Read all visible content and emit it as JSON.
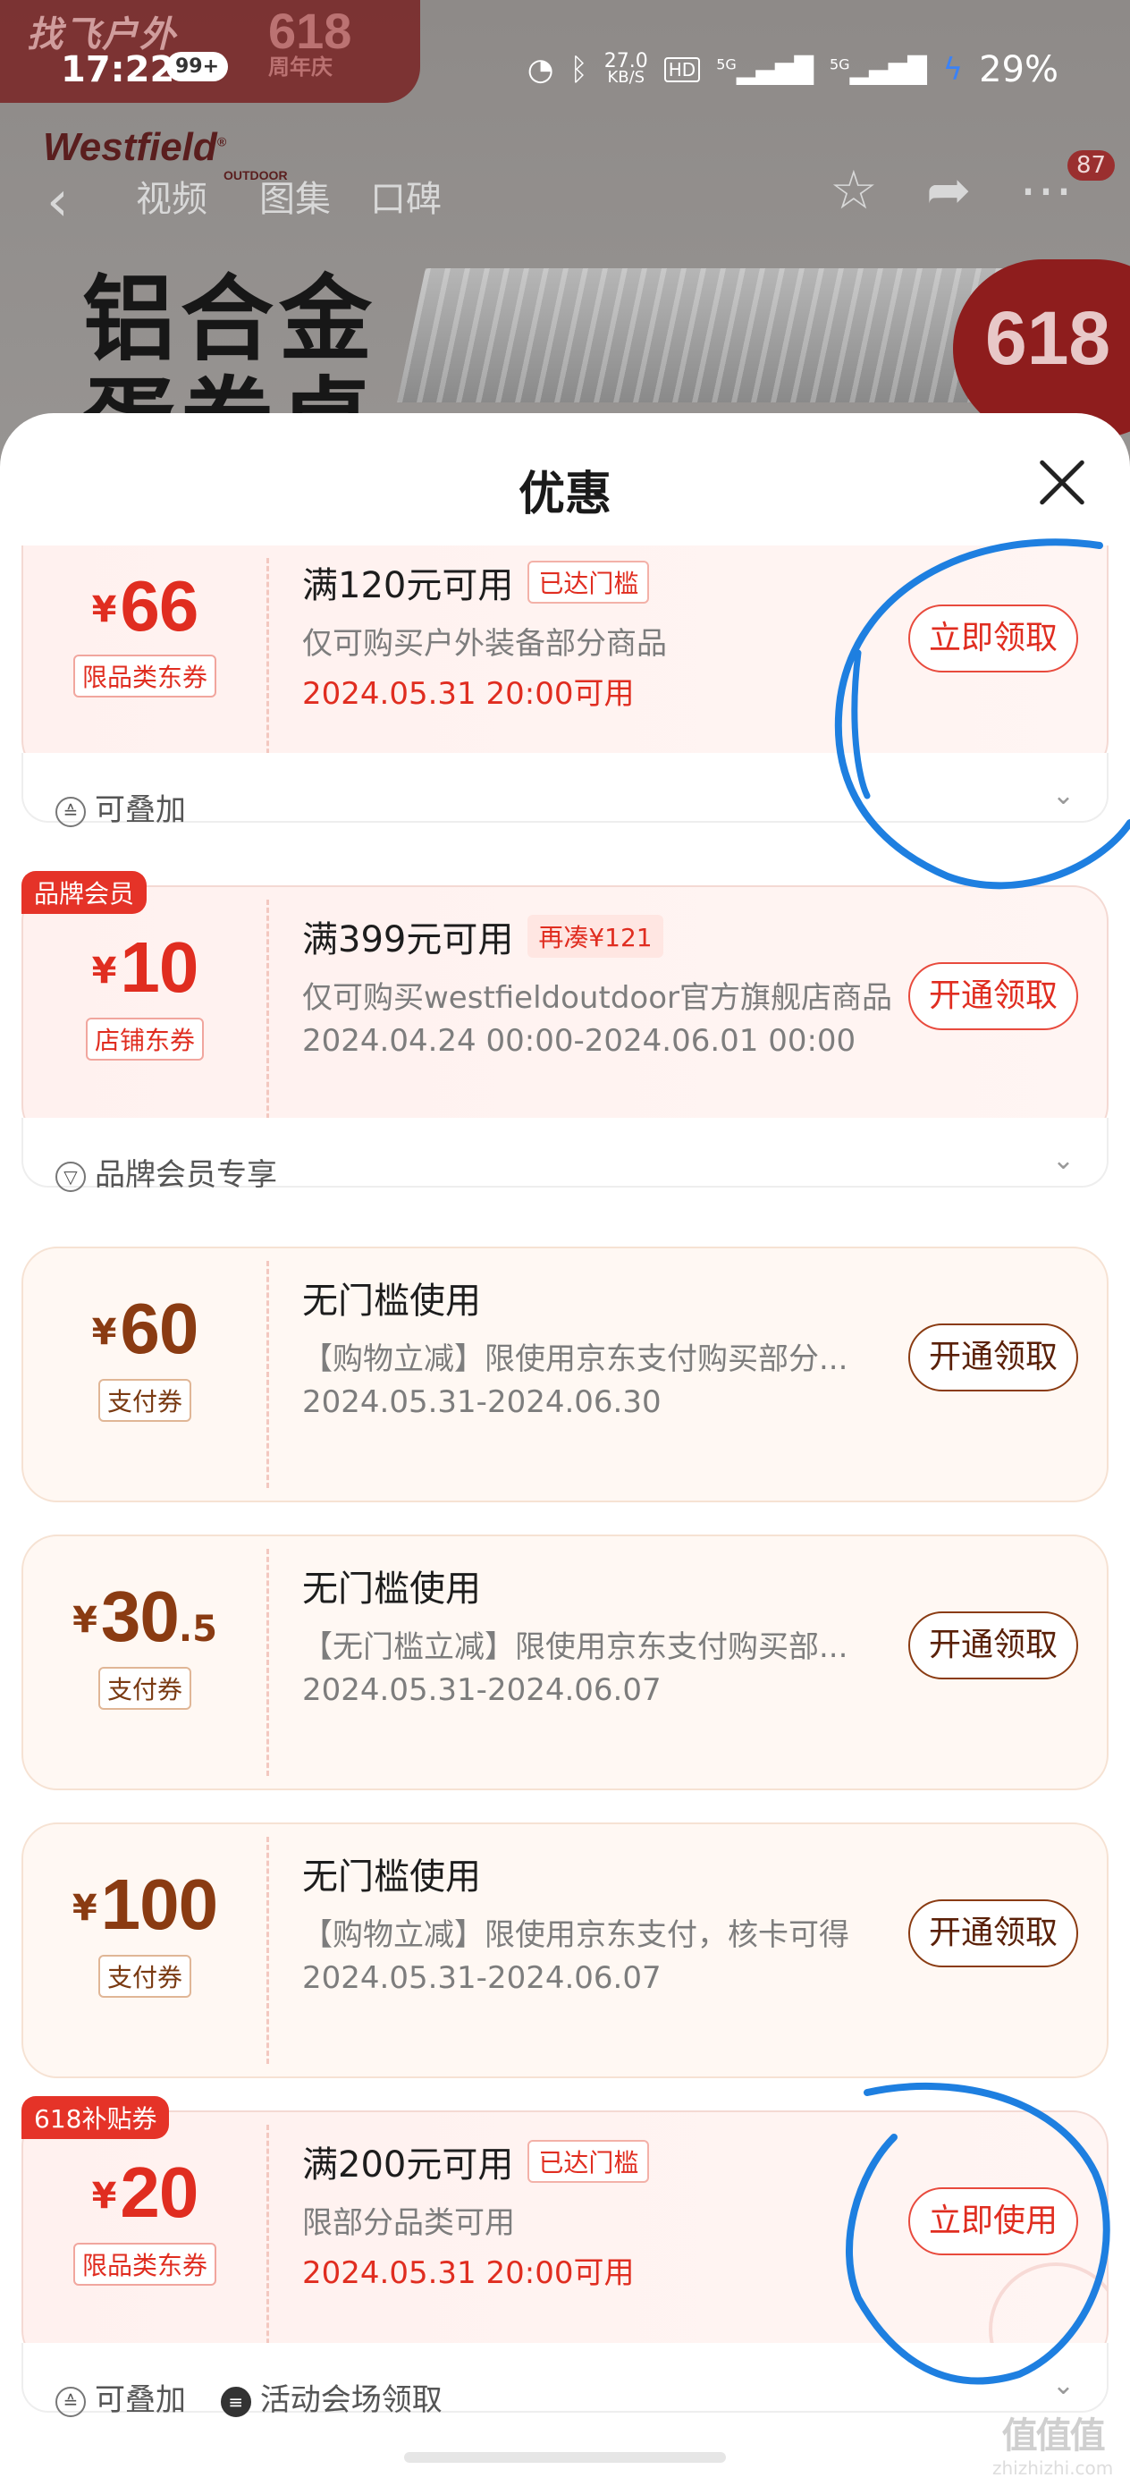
{
  "status_bar": {
    "time": "17:22",
    "notification_badge": "99+",
    "speed": "27.0",
    "speed_unit": "KB/S",
    "hd": "HD",
    "net1": "5G",
    "net2": "5G",
    "battery": "29%"
  },
  "background": {
    "banner_text": "找飞户外",
    "banner_618": "618",
    "banner_anniv": "周年庆",
    "logo": "Westfield",
    "logo_sub": "OUTDOOR",
    "headline_line1": "铝合金",
    "headline_line2": "蛋卷桌",
    "badge_618": "618",
    "nav": {
      "tab_video": "视频",
      "tab_gallery": "图集",
      "tab_reviews": "口碑",
      "more_badge": "87"
    }
  },
  "sheet": {
    "title": "优惠",
    "coupons": [
      {
        "currency": "¥",
        "amount": "66",
        "decimal": "",
        "type": "限品类东券",
        "condition": "满120元可用",
        "tag": "已达门槛",
        "description": "仅可购买户外装备部分商品",
        "date": "2024.05.31 20:00可用",
        "button": "立即领取",
        "footer": [
          "可叠加"
        ],
        "corner": ""
      },
      {
        "currency": "¥",
        "amount": "10",
        "decimal": "",
        "type": "店铺东券",
        "condition": "满399元可用",
        "tag": "再凑¥121",
        "description": "仅可购买westfieldoutdoor官方旗舰店商品",
        "date": "2024.04.24 00:00-2024.06.01 00:00",
        "button": "开通领取",
        "footer": [
          "品牌会员专享"
        ],
        "corner": "品牌会员"
      },
      {
        "currency": "¥",
        "amount": "60",
        "decimal": "",
        "type": "支付券",
        "condition": "无门槛使用",
        "tag": "",
        "description": "【购物立减】限使用京东支付购买部分...",
        "date": "2024.05.31-2024.06.30",
        "button": "开通领取",
        "footer": [],
        "corner": ""
      },
      {
        "currency": "¥",
        "amount": "30",
        "decimal": ".5",
        "type": "支付券",
        "condition": "无门槛使用",
        "tag": "",
        "description": "【无门槛立减】限使用京东支付购买部...",
        "date": "2024.05.31-2024.06.07",
        "button": "开通领取",
        "footer": [],
        "corner": ""
      },
      {
        "currency": "¥",
        "amount": "100",
        "decimal": "",
        "type": "支付券",
        "condition": "无门槛使用",
        "tag": "",
        "description": "【购物立减】限使用京东支付，核卡可得",
        "date": "2024.05.31-2024.06.07",
        "button": "开通领取",
        "footer": [],
        "corner": ""
      },
      {
        "currency": "¥",
        "amount": "20",
        "decimal": "",
        "type": "限品类东券",
        "condition": "满200元可用",
        "tag": "已达门槛",
        "description": "限部分品类可用",
        "date": "2024.05.31 20:00可用",
        "button": "立即使用",
        "footer": [
          "可叠加",
          "活动会场领取"
        ],
        "corner": "618补贴券"
      }
    ]
  },
  "watermark": {
    "logo": "值值值",
    "site": "zhizhizhi.com"
  },
  "colors": {
    "accent_red": "#e02d20",
    "pay_brown": "#8a3b12",
    "scribble_blue": "#1e7fe0"
  }
}
